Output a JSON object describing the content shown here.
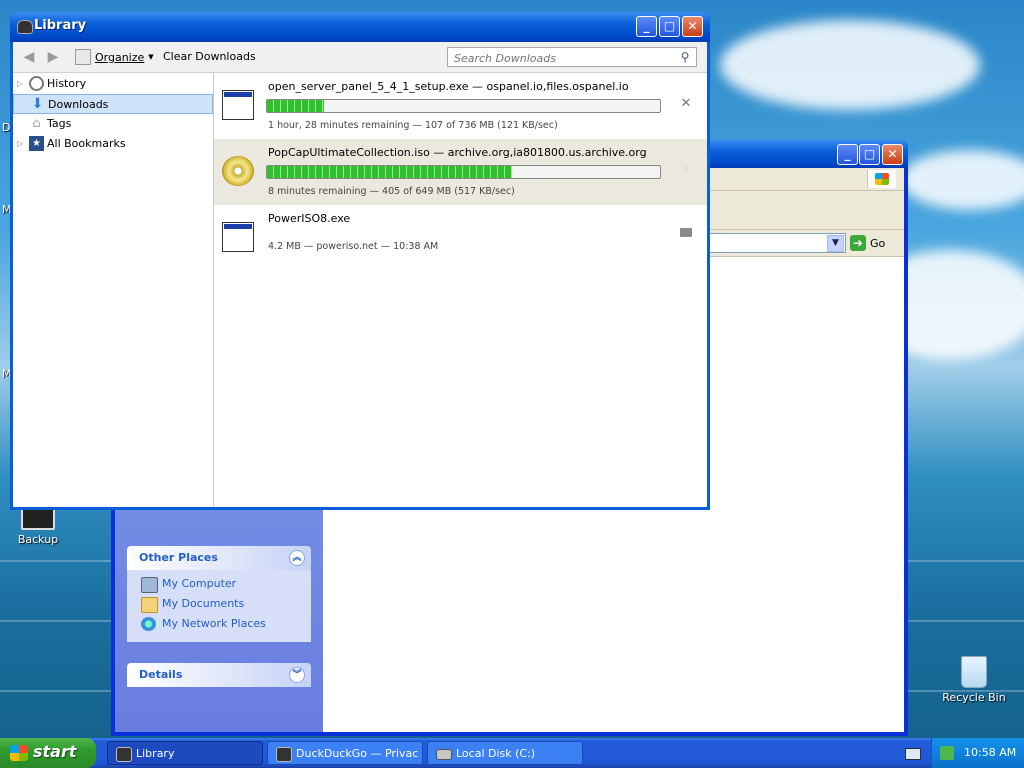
{
  "desktop": {
    "icons": [
      {
        "label": "Backup"
      },
      {
        "label": "Recycle Bin"
      }
    ],
    "edge_letters": [
      "D",
      "M",
      "M"
    ]
  },
  "explorer_window": {
    "go_label": "Go",
    "panels": [
      {
        "title": "Other Places",
        "items": [
          "My Computer",
          "My Documents",
          "My Network Places"
        ]
      },
      {
        "title": "Details",
        "items": []
      }
    ]
  },
  "library": {
    "title": "Library",
    "toolbar": {
      "organize_label": "Organize",
      "clear_label": "Clear Downloads",
      "search_placeholder": "Search Downloads"
    },
    "sidebar": [
      {
        "label": "History",
        "icon": "clock-icon",
        "has_twisty": true
      },
      {
        "label": "Downloads",
        "icon": "download-arrow-icon",
        "has_twisty": false,
        "selected": true
      },
      {
        "label": "Tags",
        "icon": "tag-icon",
        "has_twisty": false
      },
      {
        "label": "All Bookmarks",
        "icon": "star-icon",
        "has_twisty": true
      }
    ],
    "downloads": [
      {
        "name": "open_server_panel_5_4_1_setup.exe — ospanel.io,files.ospanel.io",
        "status": "1 hour, 28 minutes remaining — 107 of 736 MB (121 KB/sec)",
        "progress": 0.145,
        "icon": "exe-file-icon",
        "action": "cancel"
      },
      {
        "name": "PopCapUltimateCollection.iso — archive.org,ia801800.us.archive.org",
        "status": "8 minutes remaining — 405 of 649 MB (517 KB/sec)",
        "progress": 0.624,
        "icon": "cd-disc-icon",
        "action": "cancel"
      },
      {
        "name": "PowerISO8.exe",
        "status": "4.2 MB — poweriso.net — 10:38 AM",
        "progress": null,
        "icon": "exe-file-icon",
        "action": "open-folder"
      }
    ]
  },
  "taskbar": {
    "start_label": "start",
    "tasks": [
      {
        "label": "Library",
        "active": true
      },
      {
        "label": "DuckDuckGo — Privac...",
        "active": false
      },
      {
        "label": "Local Disk (C:)",
        "active": false
      }
    ],
    "clock": "10:58 AM"
  },
  "colors": {
    "titlebar_blue": "#0a5fd8",
    "progress_green": "#2fbf2f",
    "start_green": "#3aa83a",
    "taskpane_blue": "#215dc6"
  }
}
